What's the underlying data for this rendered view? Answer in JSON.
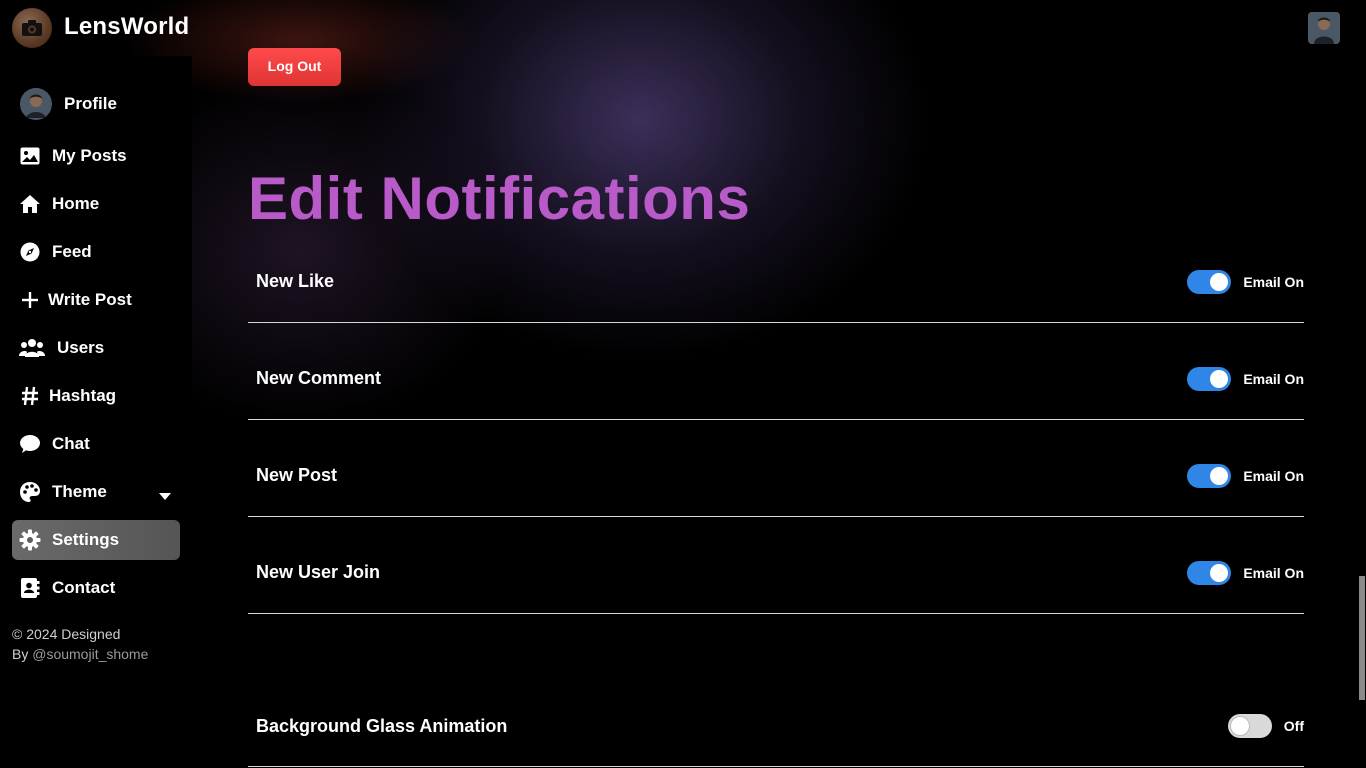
{
  "app": {
    "brand": "LensWorld",
    "logo_icon": "camera-icon",
    "avatar_icon": "user-avatar"
  },
  "sidebar": {
    "items": [
      {
        "label": "Profile",
        "icon": "avatar"
      },
      {
        "label": "My Posts",
        "icon": "image-icon"
      },
      {
        "label": "Home",
        "icon": "home-icon"
      },
      {
        "label": "Feed",
        "icon": "compass-icon"
      },
      {
        "label": "Write Post",
        "icon": "plus-icon"
      },
      {
        "label": "Users",
        "icon": "users-icon"
      },
      {
        "label": "Hashtag",
        "icon": "hashtag-icon"
      },
      {
        "label": "Chat",
        "icon": "chat-bubble-icon"
      },
      {
        "label": "Theme",
        "icon": "palette-icon"
      },
      {
        "label": "Settings",
        "icon": "gear-icon",
        "active": true
      },
      {
        "label": "Contact",
        "icon": "contact-card-icon"
      }
    ],
    "footer_line1": "© 2024 Designed",
    "footer_by": "By ",
    "footer_handle": "@soumojit_shome"
  },
  "main": {
    "logout_label": "Log Out",
    "title": "Edit Notifications",
    "notifications": [
      {
        "label": "New Like",
        "state_text": "Email On",
        "on": true
      },
      {
        "label": "New Comment",
        "state_text": "Email On",
        "on": true
      },
      {
        "label": "New Post",
        "state_text": "Email On",
        "on": true
      },
      {
        "label": "New User Join",
        "state_text": "Email On",
        "on": true
      }
    ],
    "background_animation": {
      "label": "Background Glass Animation",
      "state_text": "Off",
      "on": false
    }
  },
  "colors": {
    "title": "#b85ac8",
    "toggle_on": "#2f86e6",
    "logout": "#e03434",
    "active_nav": "#5e5e5e"
  }
}
